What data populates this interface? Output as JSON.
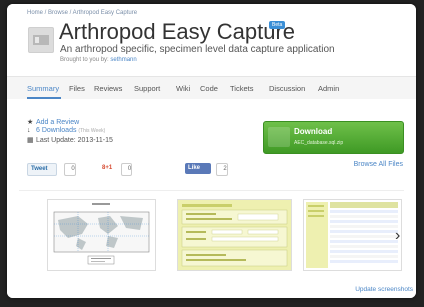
{
  "header": {
    "breadcrumb": "Home / Browse / Arthropod Easy Capture",
    "title": "Arthropod Easy Capture",
    "badge": "Beta",
    "tagline": "An arthropod specific, specimen level data capture application",
    "brought_prefix": "Brought to you by:",
    "brought_user": "sethmann"
  },
  "nav": {
    "tabs": [
      "Summary",
      "Files",
      "Reviews",
      "Support",
      "Wiki",
      "Code",
      "Tickets",
      "Discussion",
      "Admin"
    ],
    "active": "Summary"
  },
  "meta": {
    "add_review": "Add a Review",
    "downloads": "6 Downloads",
    "downloads_note": "(This Week)",
    "last_update": "Last Update: 2013-11-15"
  },
  "download": {
    "label": "Download",
    "file": "AEC_database.sql.zip",
    "browse": "Browse All Files"
  },
  "social": {
    "tweet": "Tweet",
    "tweet_count": "0",
    "gplus": "8+1",
    "gplus_count": "0",
    "like": "Like",
    "like_count": "2"
  },
  "screenshots": {
    "update_link": "Update screenshots"
  },
  "colors": {
    "link": "#4b86c6",
    "download_green": "#3f9a25",
    "beta_blue": "#3b8fd6"
  }
}
